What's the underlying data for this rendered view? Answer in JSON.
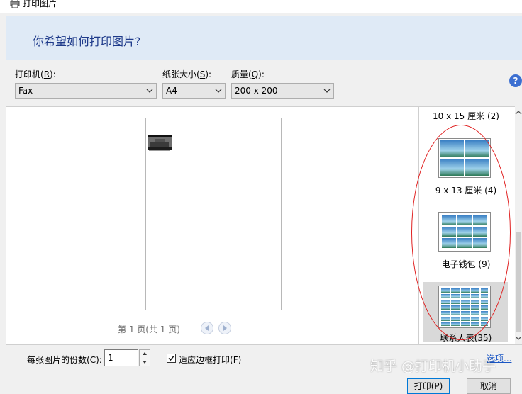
{
  "window": {
    "title": "打印图片"
  },
  "header": {
    "title": "你希望如何打印图片?"
  },
  "controls": {
    "printer": {
      "label": "打印机(",
      "key": "R",
      "label_end": "):",
      "value": "Fax"
    },
    "paper_size": {
      "label": "纸张大小(",
      "key": "S",
      "label_end": "):",
      "value": "A4"
    },
    "quality": {
      "label": "质量(",
      "key": "Q",
      "label_end": "):",
      "value": "200 x 200"
    },
    "help": "?"
  },
  "preview": {
    "page_info": "第 1 页(共 1 页)"
  },
  "layouts": {
    "items": [
      {
        "label": "10 x 15 厘米 (2)"
      },
      {
        "label": "9 x 13 厘米 (4)"
      },
      {
        "label": "电子钱包 (9)"
      },
      {
        "label": "联系人表(35)"
      }
    ],
    "selected_index": 3,
    "highlight_color": "#e02020"
  },
  "footer": {
    "copies_label": "每张图片的份数(",
    "copies_key": "C",
    "copies_label_end": "):",
    "copies_value": "1",
    "fit_label": "适应边框打印(",
    "fit_key": "F",
    "fit_label_end": ")",
    "fit_checked": true,
    "options": "选项..."
  },
  "buttons": {
    "print": "打印(P)",
    "cancel": "取消"
  },
  "watermark": "知乎 @打印机小助手"
}
